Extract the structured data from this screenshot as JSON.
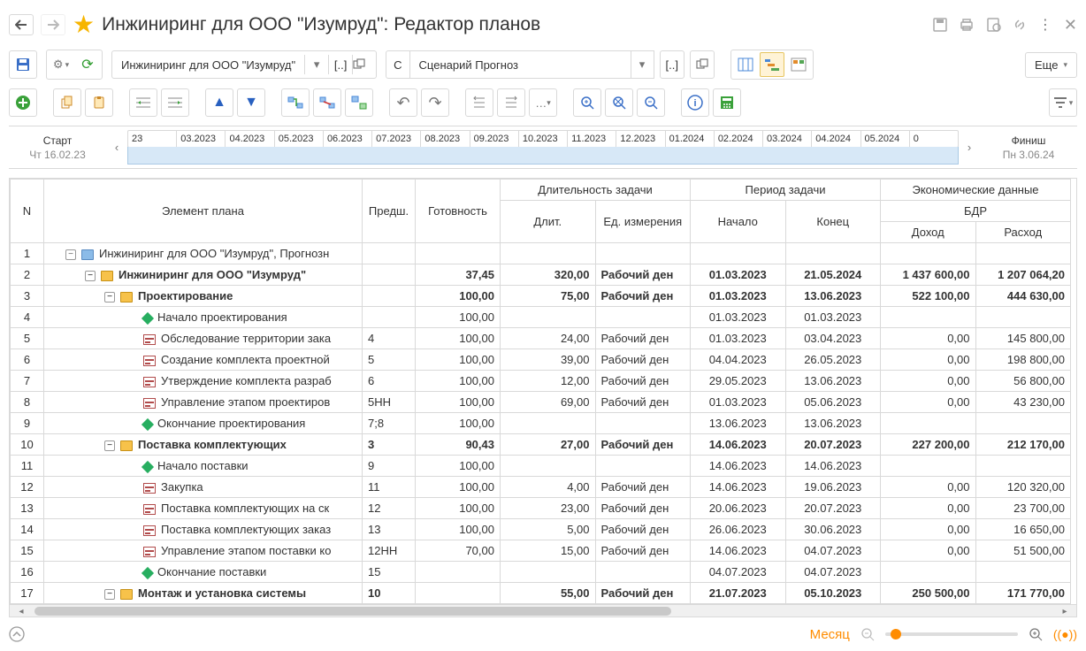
{
  "title": "Инжиниринг для ООО \"Изумруд\": Редактор планов",
  "toolbar": {
    "project": "Инжиниринг для ООО \"Изумруд\"",
    "scenario_prefix": "С",
    "scenario": "Сценарий Прогноз",
    "bracket": "[..]",
    "more": "Еще"
  },
  "timeline": {
    "start_label": "Старт",
    "start_date": "Чт 16.02.23",
    "finish_label": "Финиш",
    "finish_date": "Пн 3.06.24",
    "months": [
      "23",
      "03.2023",
      "04.2023",
      "05.2023",
      "06.2023",
      "07.2023",
      "08.2023",
      "09.2023",
      "10.2023",
      "11.2023",
      "12.2023",
      "01.2024",
      "02.2024",
      "03.2024",
      "04.2024",
      "05.2024",
      "0"
    ]
  },
  "headers": {
    "n": "N",
    "element": "Элемент плана",
    "pred": "Предш.",
    "ready": "Готовность",
    "dur_group": "Длительность задачи",
    "dur": "Длит.",
    "unit": "Ед. измерения",
    "period_group": "Период задачи",
    "start": "Начало",
    "end": "Конец",
    "econ_group": "Экономические данные",
    "bdr": "БДР",
    "income": "Доход",
    "expense": "Расход"
  },
  "rows": [
    {
      "n": "1",
      "level": 1,
      "toggle": "-",
      "icon": "folder-blue",
      "name": "Инжиниринг для ООО \"Изумруд\", Прогнозн",
      "bold": false,
      "pred": "",
      "ready": "",
      "dur": "",
      "unit": "",
      "start": "",
      "end": "",
      "income": "",
      "expense": ""
    },
    {
      "n": "2",
      "level": 2,
      "toggle": "-",
      "icon": "folder",
      "name": "Инжиниринг для ООО \"Изумруд\"",
      "bold": true,
      "pred": "",
      "ready": "37,45",
      "dur": "320,00",
      "unit": "Рабочий ден",
      "start": "01.03.2023",
      "end": "21.05.2024",
      "income": "1 437 600,00",
      "expense": "1 207 064,20"
    },
    {
      "n": "3",
      "level": 3,
      "toggle": "-",
      "icon": "folder",
      "name": "Проектирование",
      "bold": true,
      "pred": "",
      "ready": "100,00",
      "dur": "75,00",
      "unit": "Рабочий ден",
      "start": "01.03.2023",
      "end": "13.06.2023",
      "income": "522 100,00",
      "expense": "444 630,00"
    },
    {
      "n": "4",
      "level": 4,
      "toggle": "",
      "icon": "diamond",
      "name": "Начало проектирования",
      "bold": false,
      "pred": "",
      "ready": "100,00",
      "dur": "",
      "unit": "",
      "start": "01.03.2023",
      "end": "01.03.2023",
      "income": "",
      "expense": ""
    },
    {
      "n": "5",
      "level": 4,
      "toggle": "",
      "icon": "task",
      "name": "Обследование территории зака",
      "bold": false,
      "pred": "4",
      "ready": "100,00",
      "dur": "24,00",
      "unit": "Рабочий ден",
      "start": "01.03.2023",
      "end": "03.04.2023",
      "income": "0,00",
      "expense": "145 800,00"
    },
    {
      "n": "6",
      "level": 4,
      "toggle": "",
      "icon": "task",
      "name": "Создание комплекта проектной",
      "bold": false,
      "pred": "5",
      "ready": "100,00",
      "dur": "39,00",
      "unit": "Рабочий ден",
      "start": "04.04.2023",
      "end": "26.05.2023",
      "income": "0,00",
      "expense": "198 800,00"
    },
    {
      "n": "7",
      "level": 4,
      "toggle": "",
      "icon": "task",
      "name": "Утверждение комплекта разраб",
      "bold": false,
      "pred": "6",
      "ready": "100,00",
      "dur": "12,00",
      "unit": "Рабочий ден",
      "start": "29.05.2023",
      "end": "13.06.2023",
      "income": "0,00",
      "expense": "56 800,00"
    },
    {
      "n": "8",
      "level": 4,
      "toggle": "",
      "icon": "task",
      "name": "Управление этапом проектиров",
      "bold": false,
      "pred": "5НН",
      "ready": "100,00",
      "dur": "69,00",
      "unit": "Рабочий ден",
      "start": "01.03.2023",
      "end": "05.06.2023",
      "income": "0,00",
      "expense": "43 230,00"
    },
    {
      "n": "9",
      "level": 4,
      "toggle": "",
      "icon": "diamond",
      "name": "Окончание проектирования",
      "bold": false,
      "pred": "7;8",
      "ready": "100,00",
      "dur": "",
      "unit": "",
      "start": "13.06.2023",
      "end": "13.06.2023",
      "income": "",
      "expense": ""
    },
    {
      "n": "10",
      "level": 3,
      "toggle": "-",
      "icon": "folder",
      "name": "Поставка комплектующих",
      "bold": true,
      "pred": "3",
      "ready": "90,43",
      "dur": "27,00",
      "unit": "Рабочий ден",
      "start": "14.06.2023",
      "end": "20.07.2023",
      "income": "227 200,00",
      "expense": "212 170,00"
    },
    {
      "n": "11",
      "level": 4,
      "toggle": "",
      "icon": "diamond",
      "name": "Начало поставки",
      "bold": false,
      "pred": "9",
      "ready": "100,00",
      "dur": "",
      "unit": "",
      "start": "14.06.2023",
      "end": "14.06.2023",
      "income": "",
      "expense": ""
    },
    {
      "n": "12",
      "level": 4,
      "toggle": "",
      "icon": "task",
      "name": "Закупка",
      "bold": false,
      "pred": "11",
      "ready": "100,00",
      "dur": "4,00",
      "unit": "Рабочий ден",
      "start": "14.06.2023",
      "end": "19.06.2023",
      "income": "0,00",
      "expense": "120 320,00"
    },
    {
      "n": "13",
      "level": 4,
      "toggle": "",
      "icon": "task",
      "name": "Поставка комплектующих на ск",
      "bold": false,
      "pred": "12",
      "ready": "100,00",
      "dur": "23,00",
      "unit": "Рабочий ден",
      "start": "20.06.2023",
      "end": "20.07.2023",
      "income": "0,00",
      "expense": "23 700,00"
    },
    {
      "n": "14",
      "level": 4,
      "toggle": "",
      "icon": "task",
      "name": "Поставка комплектующих заказ",
      "bold": false,
      "pred": "13",
      "ready": "100,00",
      "dur": "5,00",
      "unit": "Рабочий ден",
      "start": "26.06.2023",
      "end": "30.06.2023",
      "income": "0,00",
      "expense": "16 650,00"
    },
    {
      "n": "15",
      "level": 4,
      "toggle": "",
      "icon": "task",
      "name": "Управление этапом поставки ко",
      "bold": false,
      "pred": "12НН",
      "ready": "70,00",
      "dur": "15,00",
      "unit": "Рабочий ден",
      "start": "14.06.2023",
      "end": "04.07.2023",
      "income": "0,00",
      "expense": "51 500,00"
    },
    {
      "n": "16",
      "level": 4,
      "toggle": "",
      "icon": "diamond",
      "name": "Окончание поставки",
      "bold": false,
      "pred": "15",
      "ready": "",
      "dur": "",
      "unit": "",
      "start": "04.07.2023",
      "end": "04.07.2023",
      "income": "",
      "expense": ""
    },
    {
      "n": "17",
      "level": 3,
      "toggle": "-",
      "icon": "folder",
      "name": "Монтаж и установка системы",
      "bold": true,
      "pred": "10",
      "ready": "",
      "dur": "55,00",
      "unit": "Рабочий ден",
      "start": "21.07.2023",
      "end": "05.10.2023",
      "income": "250 500,00",
      "expense": "171 770,00"
    }
  ],
  "footer": {
    "zoom_label": "Месяц"
  }
}
